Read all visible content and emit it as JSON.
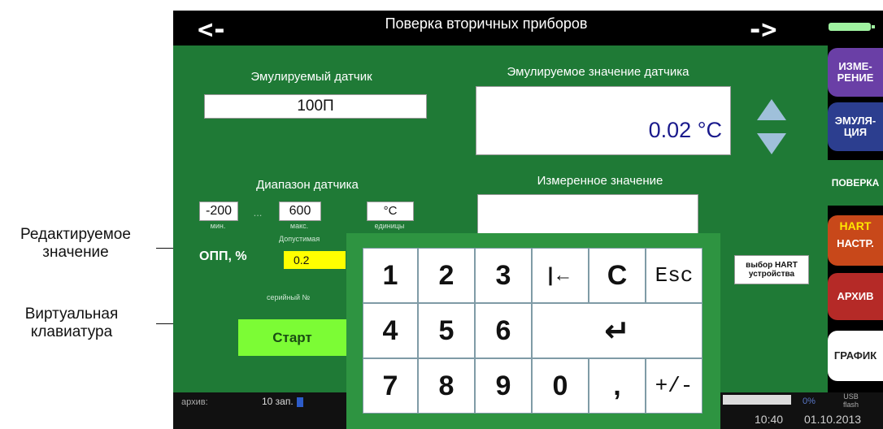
{
  "annotations": {
    "editable_label": [
      "Редактируемое",
      "значение"
    ],
    "keyboard_label": [
      "Виртуальная",
      "клавиатура"
    ]
  },
  "header": {
    "back": "<-",
    "forward": "->",
    "title": "Поверка вторичных приборов"
  },
  "sensor": {
    "label": "Эмулируемый датчик",
    "value": "100П"
  },
  "emulated": {
    "label": "Эмулируемое значение датчика",
    "value": "0.02 °C"
  },
  "measured": {
    "label": "Измеренное значение",
    "value": ""
  },
  "range": {
    "label": "Диапазон датчика",
    "min": "-200",
    "min_caption": "мин.",
    "max": "600",
    "max_caption": "макс.",
    "unit": "°C",
    "unit_caption": "единицы",
    "dots": "..."
  },
  "tolerance": {
    "caption": "Допустимая",
    "label": "ОПП, %",
    "value": "0.2"
  },
  "serial_label": "серийный №",
  "start_button": "Старт",
  "hart_select": [
    "выбор HART",
    "устройства"
  ],
  "tabs": {
    "measure": [
      "ИЗМЕ-",
      "РЕНИЕ"
    ],
    "emulation": [
      "ЭМУЛЯ-",
      "ЦИЯ"
    ],
    "verify": "ПОВЕРКА",
    "hart": "HART",
    "settings": "НАСТР.",
    "archive": "АРХИВ",
    "graph": "ГРАФИК"
  },
  "status": {
    "archive_label": "архив:",
    "records": "10 зап.",
    "percent": "0%",
    "usb": [
      "USB",
      "flash"
    ],
    "time": "10:40",
    "date": "01.10.2013"
  },
  "keypad": {
    "row1": [
      "1",
      "2",
      "3",
      "|←",
      "C",
      "Esc"
    ],
    "row2": [
      "4",
      "5",
      "6",
      "↵"
    ],
    "row3": [
      "7",
      "8",
      "9",
      "0",
      ",",
      "+/-"
    ]
  },
  "colors": {
    "panel": "#1f7a36",
    "tolerance_field": "#ffff00",
    "start_button": "#7cfc35"
  }
}
